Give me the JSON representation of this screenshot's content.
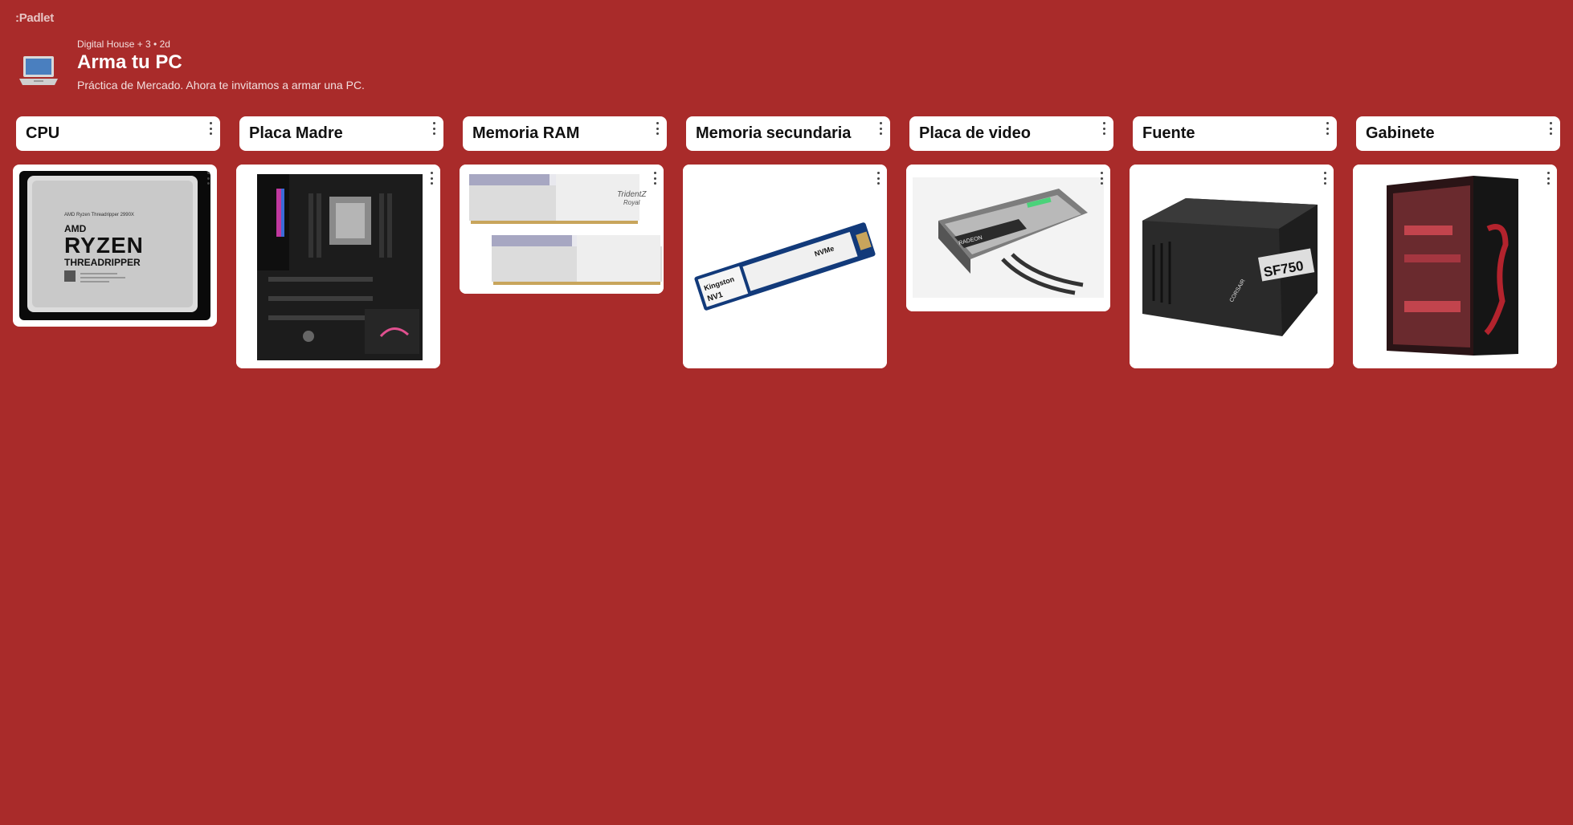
{
  "app": {
    "logo": ":Padlet"
  },
  "header": {
    "meta": "Digital House + 3 • 2d",
    "title": "Arma tu PC",
    "description": "Práctica de Mercado. Ahora te invitamos a armar una PC."
  },
  "columns": [
    {
      "label": "CPU"
    },
    {
      "label": "Placa Madre"
    },
    {
      "label": "Memoria RAM"
    },
    {
      "label": "Memoria secundaria"
    },
    {
      "label": "Placa de video"
    },
    {
      "label": "Fuente"
    },
    {
      "label": "Gabinete"
    }
  ],
  "images": {
    "cpu": {
      "line1": "AMD Ryzen Threadripper 2990X",
      "line2": "AMD",
      "line3": "RYZEN",
      "line4": "THREADRIPPER"
    },
    "ram": {
      "brand": "TridentZ",
      "sub": "Royal"
    },
    "ssd": {
      "brand": "Kingston",
      "model": "NV1",
      "spec": "NVMe"
    },
    "gpu": {
      "brand": "RADEON"
    },
    "psu": {
      "brand": "CORSAIR",
      "model": "SF750"
    }
  }
}
